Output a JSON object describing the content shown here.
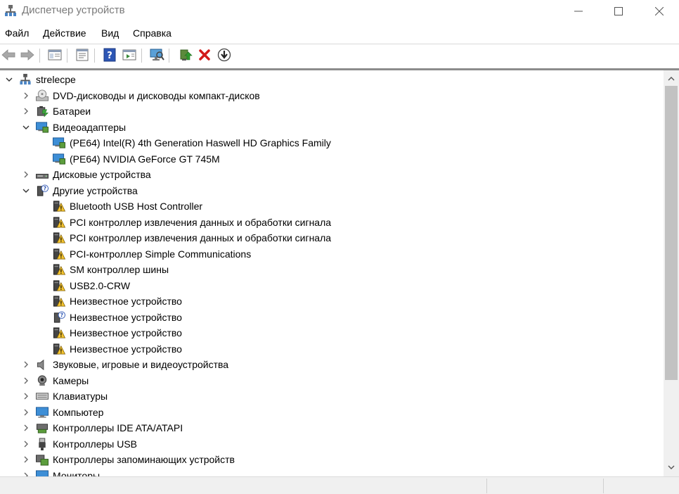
{
  "window": {
    "title": "Диспетчер устройств"
  },
  "menu": [
    "Файл",
    "Действие",
    "Вид",
    "Справка"
  ],
  "toolbar": {
    "buttons": [
      "back-icon",
      "forward-icon",
      "show-hide-tree-icon",
      "properties-icon",
      "help-icon",
      "view-icon",
      "scan-hardware-icon",
      "update-driver-icon",
      "uninstall-icon",
      "disable-device-icon"
    ]
  },
  "tree": {
    "root": "strelecpe",
    "rows": [
      {
        "label": "strelecpe",
        "level": 0,
        "expand": "open",
        "icon": "computer-root"
      },
      {
        "label": "DVD-дисководы и дисководы компакт-дисков",
        "level": 1,
        "expand": "closed",
        "icon": "dvd"
      },
      {
        "label": "Батареи",
        "level": 1,
        "expand": "closed",
        "icon": "battery"
      },
      {
        "label": "Видеоадаптеры",
        "level": 1,
        "expand": "open",
        "icon": "display"
      },
      {
        "label": "(PE64) Intel(R) 4th Generation Haswell HD Graphics Family",
        "level": 2,
        "expand": "none",
        "icon": "display"
      },
      {
        "label": "(PE64) NVIDIA GeForce GT 745M",
        "level": 2,
        "expand": "none",
        "icon": "display"
      },
      {
        "label": "Дисковые устройства",
        "level": 1,
        "expand": "closed",
        "icon": "disk"
      },
      {
        "label": "Другие устройства",
        "level": 1,
        "expand": "open",
        "icon": "unknown"
      },
      {
        "label": "Bluetooth USB Host Controller",
        "level": 2,
        "expand": "none",
        "icon": "warning-device"
      },
      {
        "label": "PCI контроллер извлечения данных и обработки сигнала",
        "level": 2,
        "expand": "none",
        "icon": "warning-device"
      },
      {
        "label": "PCI контроллер извлечения данных и обработки сигнала",
        "level": 2,
        "expand": "none",
        "icon": "warning-device"
      },
      {
        "label": "PCI-контроллер Simple Communications",
        "level": 2,
        "expand": "none",
        "icon": "warning-device"
      },
      {
        "label": "SM контроллер шины",
        "level": 2,
        "expand": "none",
        "icon": "warning-device"
      },
      {
        "label": "USB2.0-CRW",
        "level": 2,
        "expand": "none",
        "icon": "warning-device"
      },
      {
        "label": "Неизвестное устройство",
        "level": 2,
        "expand": "none",
        "icon": "warning-device"
      },
      {
        "label": "Неизвестное устройство",
        "level": 2,
        "expand": "none",
        "icon": "unknown"
      },
      {
        "label": "Неизвестное устройство",
        "level": 2,
        "expand": "none",
        "icon": "warning-device"
      },
      {
        "label": "Неизвестное устройство",
        "level": 2,
        "expand": "none",
        "icon": "warning-device"
      },
      {
        "label": "Звуковые, игровые и видеоустройства",
        "level": 1,
        "expand": "closed",
        "icon": "speaker"
      },
      {
        "label": "Камеры",
        "level": 1,
        "expand": "closed",
        "icon": "camera"
      },
      {
        "label": "Клавиатуры",
        "level": 1,
        "expand": "closed",
        "icon": "keyboard"
      },
      {
        "label": "Компьютер",
        "level": 1,
        "expand": "closed",
        "icon": "monitor"
      },
      {
        "label": "Контроллеры IDE ATA/ATAPI",
        "level": 1,
        "expand": "closed",
        "icon": "ide"
      },
      {
        "label": "Контроллеры USB",
        "level": 1,
        "expand": "closed",
        "icon": "usb"
      },
      {
        "label": "Контроллеры запоминающих устройств",
        "level": 1,
        "expand": "closed",
        "icon": "storage"
      },
      {
        "label": "Мониторы",
        "level": 1,
        "expand": "closed",
        "icon": "monitor"
      }
    ]
  }
}
